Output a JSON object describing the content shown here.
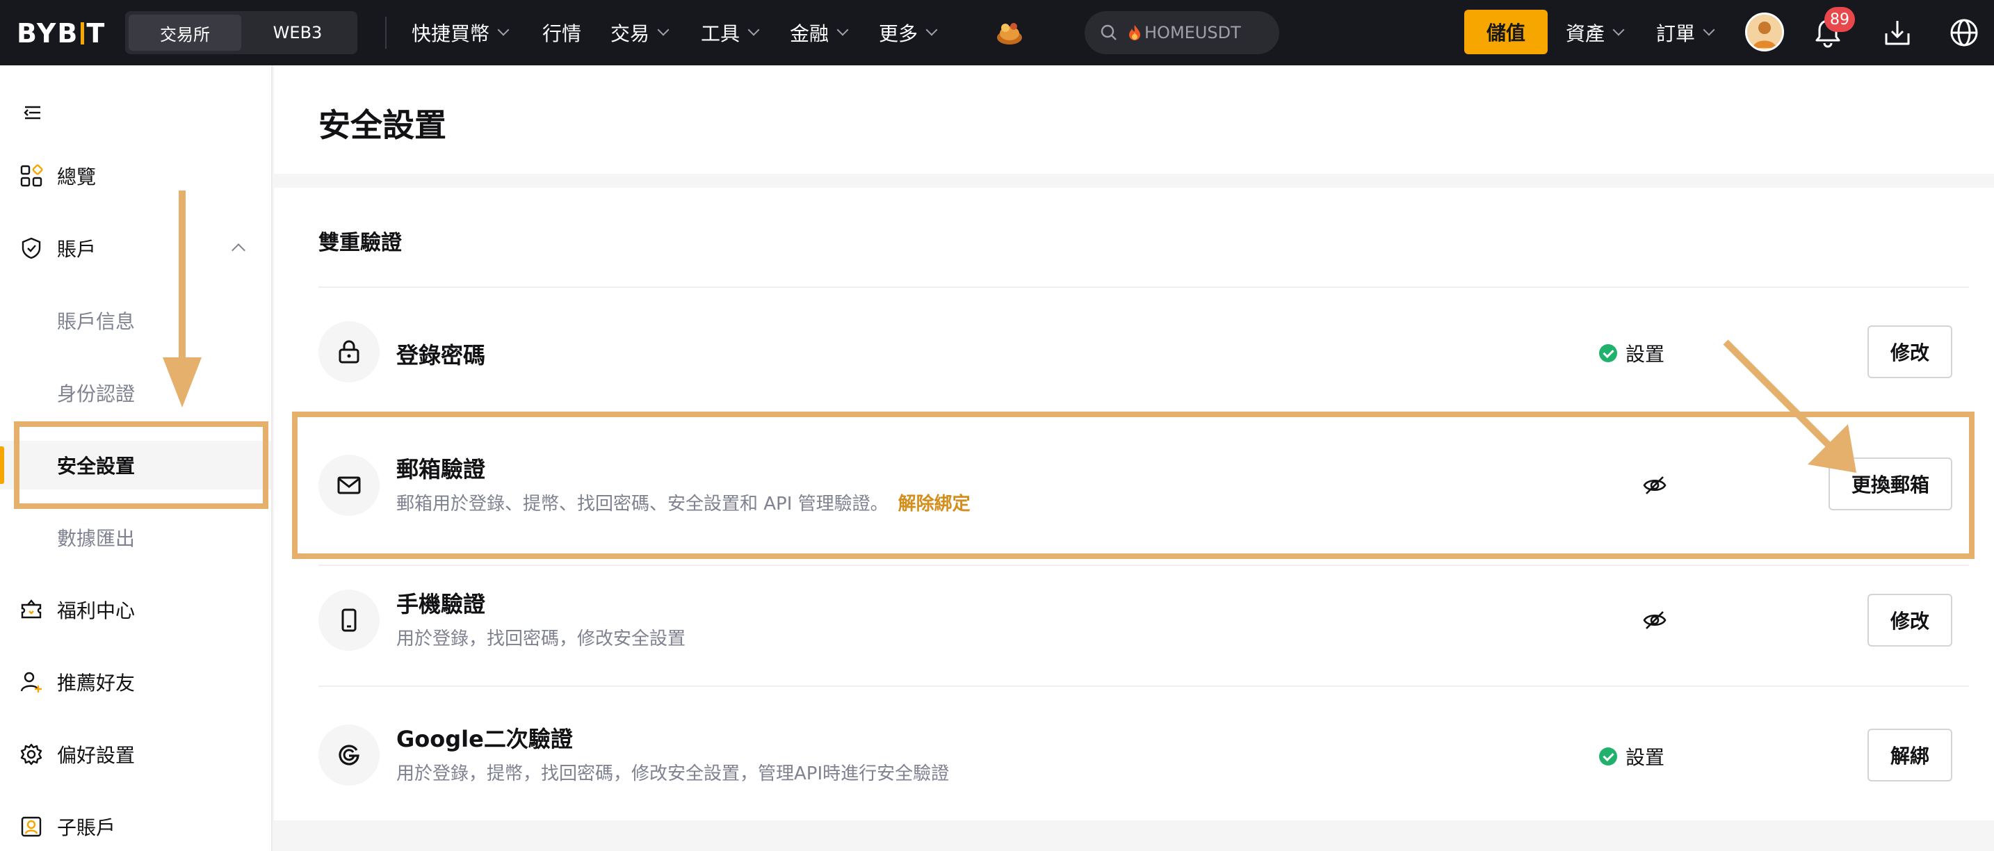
{
  "nav": {
    "logo": "BYBIT",
    "segment": [
      "交易所",
      "WEB3"
    ],
    "menu": [
      {
        "label": "快捷買幣",
        "dropdown": true
      },
      {
        "label": "行情",
        "dropdown": false
      },
      {
        "label": "交易",
        "dropdown": true
      },
      {
        "label": "工具",
        "dropdown": true
      },
      {
        "label": "金融",
        "dropdown": true
      },
      {
        "label": "更多",
        "dropdown": true
      }
    ],
    "search_text": "HOMEUSDT",
    "deposit_label": "儲值",
    "assets_label": "資產",
    "orders_label": "訂單",
    "notification_count": "89"
  },
  "sidebar": {
    "items": [
      {
        "label": "總覽",
        "icon": "grid-icon"
      },
      {
        "label": "賬戶",
        "icon": "shield-icon"
      },
      {
        "label": "賬戶信息"
      },
      {
        "label": "身份認證"
      },
      {
        "label": "安全設置"
      },
      {
        "label": "數據匯出"
      },
      {
        "label": "福利中心",
        "icon": "ticket-icon"
      },
      {
        "label": "推薦好友",
        "icon": "referral-icon"
      },
      {
        "label": "偏好設置",
        "icon": "gear-icon"
      },
      {
        "label": "子賬戶",
        "icon": "subaccount-icon"
      }
    ]
  },
  "main": {
    "page_title": "安全設置",
    "section_title": "雙重驗證",
    "rows": [
      {
        "title": "登錄密碼",
        "desc": "",
        "status": "設置",
        "button": "修改",
        "icon": "lock-icon"
      },
      {
        "title": "郵箱驗證",
        "desc": "郵箱用於登錄、提幣、找回密碼、安全設置和 API 管理驗證。",
        "link": "解除綁定",
        "status": "",
        "button": "更換郵箱",
        "icon": "mail-icon"
      },
      {
        "title": "手機驗證",
        "desc": "用於登錄，找回密碼，修改安全設置",
        "status": "",
        "button": "修改",
        "icon": "phone-icon"
      },
      {
        "title": "Google二次驗證",
        "desc": "用於登錄，提幣，找回密碼，修改安全設置，管理API時進行安全驗證",
        "status": "設置",
        "button": "解綁",
        "icon": "google-icon"
      }
    ]
  },
  "colors": {
    "accent": "#f7a600",
    "annotation": "#e4b06c",
    "success": "#20b26c",
    "nav_bg": "#17181e"
  }
}
